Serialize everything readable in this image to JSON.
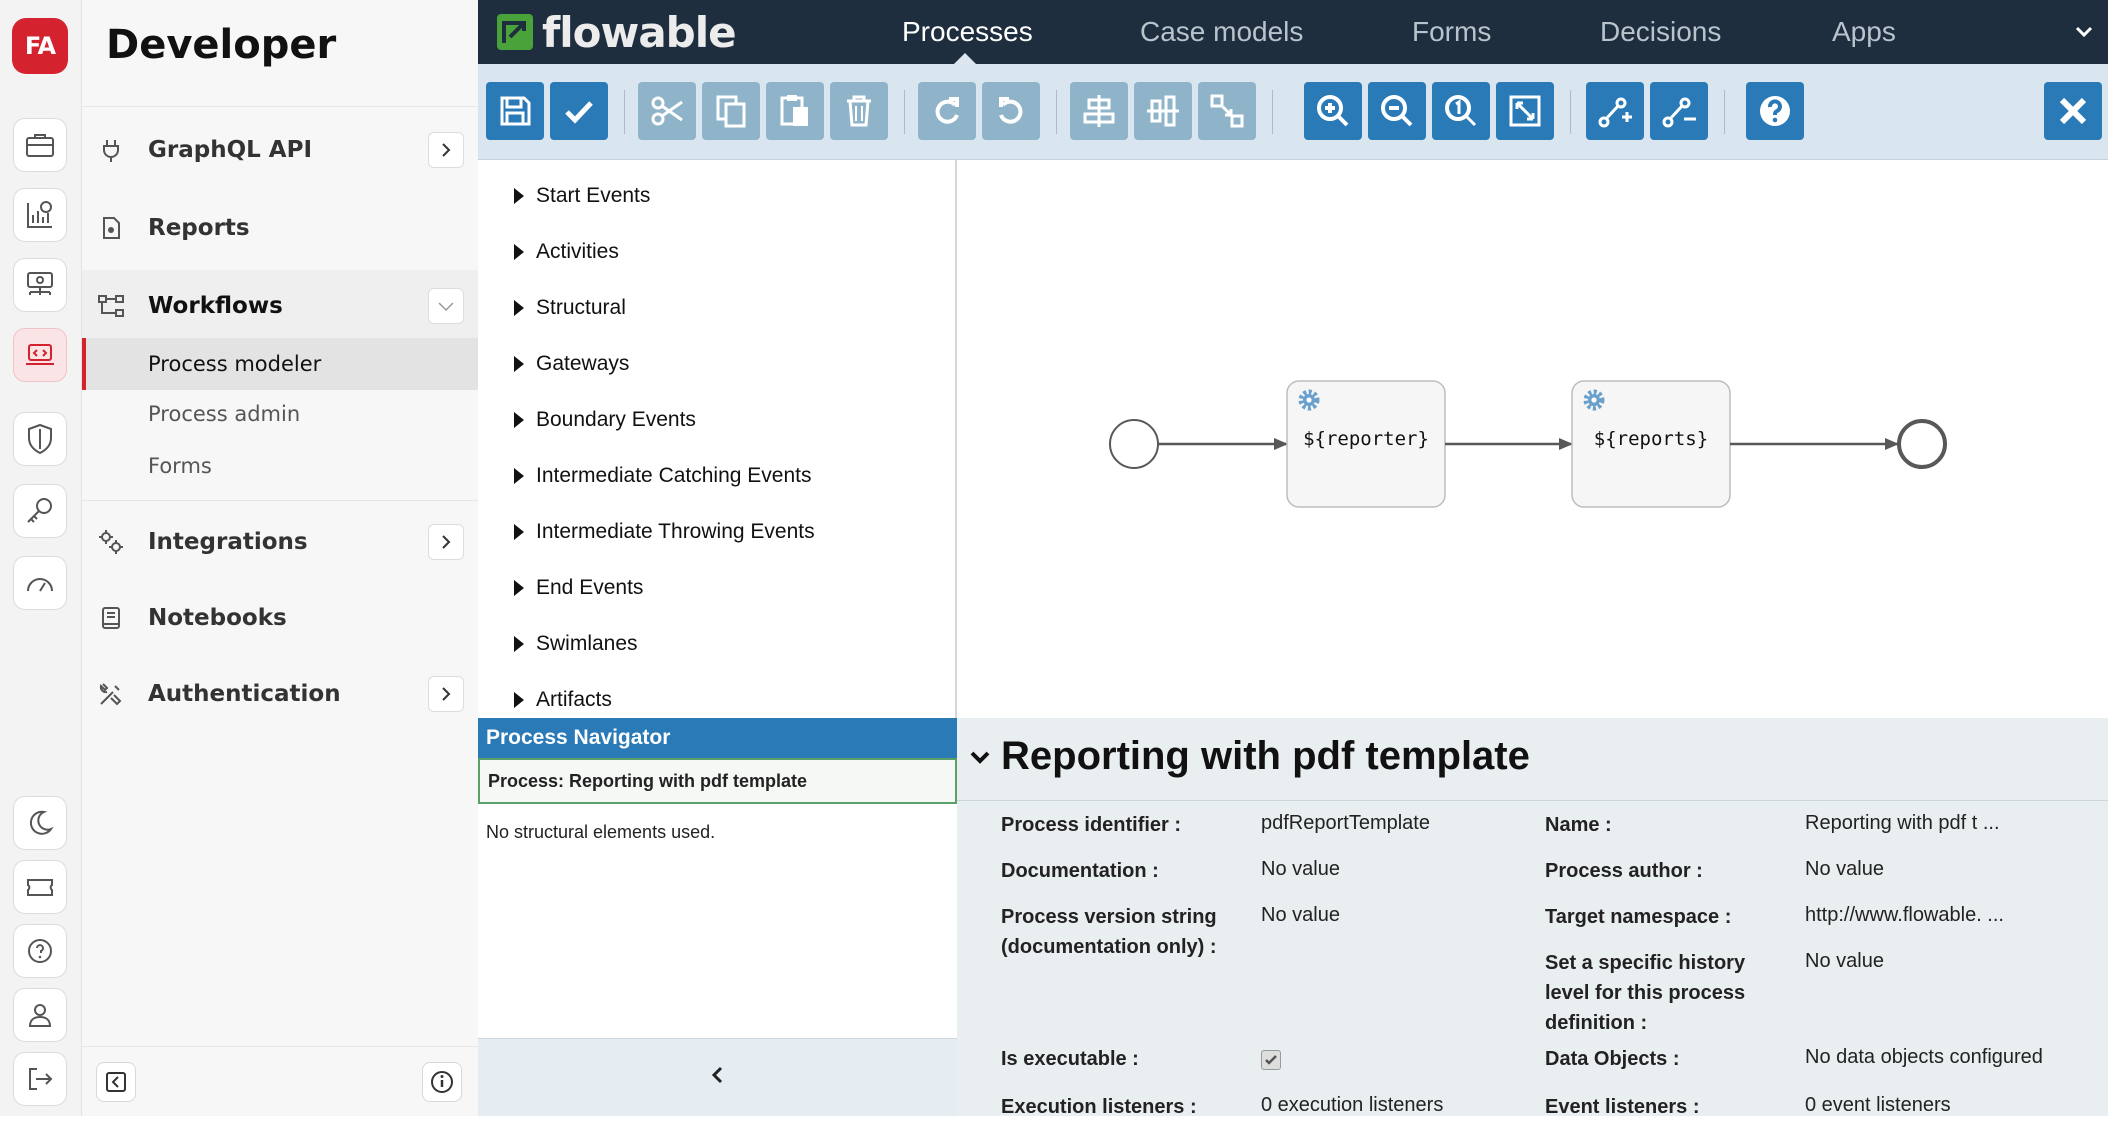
{
  "rail": {
    "logo_text": "FA",
    "icons": [
      "briefcase-icon",
      "reports-chart-icon",
      "network-icon",
      "code-laptop-icon",
      "shield-icon",
      "key-icon",
      "gauge-icon",
      "moon-icon",
      "ticket-icon",
      "help-icon",
      "user-icon",
      "logout-icon"
    ],
    "accent_color": "#d4232f"
  },
  "sidenav": {
    "title": "Developer",
    "items": [
      {
        "label": "GraphQL API",
        "icon": "plug-icon",
        "expandable": true
      },
      {
        "label": "Reports",
        "icon": "document-icon",
        "expandable": false
      },
      {
        "label": "Workflows",
        "icon": "workflow-icon",
        "expandable": true,
        "expanded": true
      },
      {
        "label": "Integrations",
        "icon": "gears-icon",
        "expandable": true
      },
      {
        "label": "Notebooks",
        "icon": "notebook-icon",
        "expandable": false
      },
      {
        "label": "Authentication",
        "icon": "tools-icon",
        "expandable": true
      }
    ],
    "workflow_subitems": [
      {
        "label": "Process modeler",
        "active": true
      },
      {
        "label": "Process admin",
        "active": false
      },
      {
        "label": "Forms",
        "active": false
      }
    ]
  },
  "topnav": {
    "brand": "flowable",
    "tabs": [
      {
        "label": "Processes",
        "active": true
      },
      {
        "label": "Case models",
        "active": false
      },
      {
        "label": "Forms",
        "active": false
      },
      {
        "label": "Decisions",
        "active": false
      },
      {
        "label": "Apps",
        "active": false
      }
    ]
  },
  "toolbar": {
    "buttons": [
      "save-icon",
      "validate-icon",
      "cut-icon",
      "copy-icon",
      "paste-icon",
      "delete-icon",
      "redo-icon",
      "undo-icon",
      "align-horizontal-icon",
      "align-vertical-icon",
      "same-size-icon",
      "zoom-in-icon",
      "zoom-out-icon",
      "zoom-actual-icon",
      "zoom-fit-icon",
      "add-bendpoint-icon",
      "remove-bendpoint-icon",
      "help-icon",
      "close-icon"
    ]
  },
  "palette": {
    "groups": [
      "Start Events",
      "Activities",
      "Structural",
      "Gateways",
      "Boundary Events",
      "Intermediate Catching Events",
      "Intermediate Throwing Events",
      "End Events",
      "Swimlanes",
      "Artifacts"
    ]
  },
  "navigator": {
    "header": "Process Navigator",
    "process": "Process: Reporting with pdf template",
    "empty_text": "No structural elements used."
  },
  "diagram": {
    "tasks": [
      {
        "label": "${reporter}"
      },
      {
        "label": "${reports}"
      }
    ]
  },
  "properties": {
    "title": "Reporting with pdf template",
    "left": [
      {
        "label": "Process identifier :",
        "value": "pdfReportTemplate"
      },
      {
        "label": "Documentation :",
        "value": "No value"
      },
      {
        "label": "Process version string (documentation only) :",
        "value": "No value"
      },
      {
        "label": "Is executable :",
        "value": "",
        "checked": true
      },
      {
        "label": "Execution listeners :",
        "value": "0 execution listeners"
      }
    ],
    "right": [
      {
        "label": "Name :",
        "value": "Reporting with pdf t ..."
      },
      {
        "label": "Process author :",
        "value": "No value"
      },
      {
        "label": "Target namespace :",
        "value": "http://www.flowable. ..."
      },
      {
        "label": "Set a specific history level for this process definition :",
        "value": "No value"
      },
      {
        "label": "Data Objects :",
        "value": "No data objects configured"
      },
      {
        "label": "Event listeners :",
        "value": "0 event listeners"
      }
    ]
  }
}
